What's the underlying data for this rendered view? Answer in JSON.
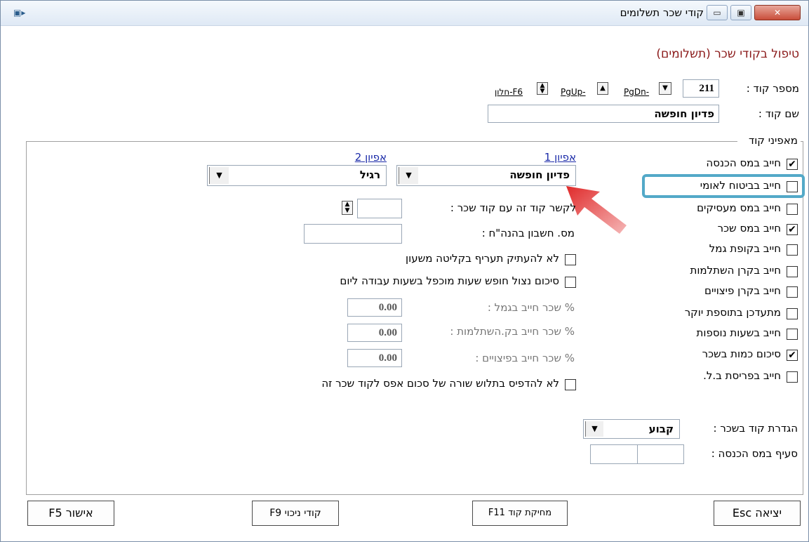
{
  "window": {
    "title": "קודי שכר תשלומים",
    "app_icon": "app-icon",
    "min_glyph": "▭",
    "max_glyph": "▣",
    "close_glyph": "✕"
  },
  "header": {
    "title": "טיפול בקודי שכר (תשלומים)"
  },
  "code": {
    "number_label": "מספר קוד :",
    "number_value": "211",
    "name_label": "שם קוד :",
    "name_value": "פדיון חופשה",
    "nav": {
      "pgdn": "PgDn-",
      "pgup": "PgUp-",
      "window": "חלון-F6"
    }
  },
  "characteristics": {
    "legend": "מאפיני קוד",
    "items": [
      {
        "label": "חייב במס הכנסה",
        "checked": true
      },
      {
        "label": "חייב בביטוח לאומי",
        "checked": false
      },
      {
        "label": "חייב במס מעסיקים",
        "checked": false
      },
      {
        "label": "חייב במס שכר",
        "checked": true
      },
      {
        "label": "חייב בקופת גמל",
        "checked": false
      },
      {
        "label": "חייב בקרן השתלמות",
        "checked": false
      },
      {
        "label": "חייב בקרן פיצויים",
        "checked": false
      },
      {
        "label": "מתעדכן בתוספת יוקר",
        "checked": false
      },
      {
        "label": "חייב בשעות נוספות",
        "checked": false
      },
      {
        "label": "סיכום כמות בשכר",
        "checked": true
      },
      {
        "label": "חייב בפריסת ב.ל.",
        "checked": false
      }
    ]
  },
  "features": {
    "feature1_label": "אפיון 1",
    "feature1_value": "פדיון חופשה",
    "feature2_label": "אפיון 2",
    "feature2_value": "רגיל"
  },
  "fields": {
    "link_label": "לקשר קוד זה עם קוד שכר :",
    "link_value": "",
    "account_label": "מס. חשבון בהנה\"ח :",
    "account_value": "",
    "no_copy_rate": "לא להעתיק תעריף בקליטה משעון",
    "vacation_sum": "סיכום נצול חופש שעות מוכפל בשעות עבודה ליום",
    "pct_gemel_label": "% שכר חייב בגמל :",
    "pct_gemel_value": "0.00",
    "pct_hishtalmut_label": "% שכר חייב בק.השתלמות :",
    "pct_hishtalmut_value": "0.00",
    "pct_pitzuim_label": "% שכר חייב בפיצויים :",
    "pct_pitzuim_value": "0.00",
    "no_print_zero": "לא להדפיס בתלוש שורה של סכום אפס לקוד שכר זה",
    "definition_label": "הגדרת קוד בשכר :",
    "definition_value": "קבוע",
    "tax_section_label": "סעיף במס הכנסה :",
    "tax_section_a": "",
    "tax_section_b": ""
  },
  "buttons": {
    "exit": "יציאה Esc",
    "delete": "מחיקת קוד F11",
    "deduction": "קודי ניכוי F9",
    "confirm": "אישור F5"
  },
  "colors": {
    "highlight": "#53a9c8",
    "arrow": "#e02a2a",
    "title_red": "#8b1a1a",
    "link_blue": "#1a2aa8"
  }
}
